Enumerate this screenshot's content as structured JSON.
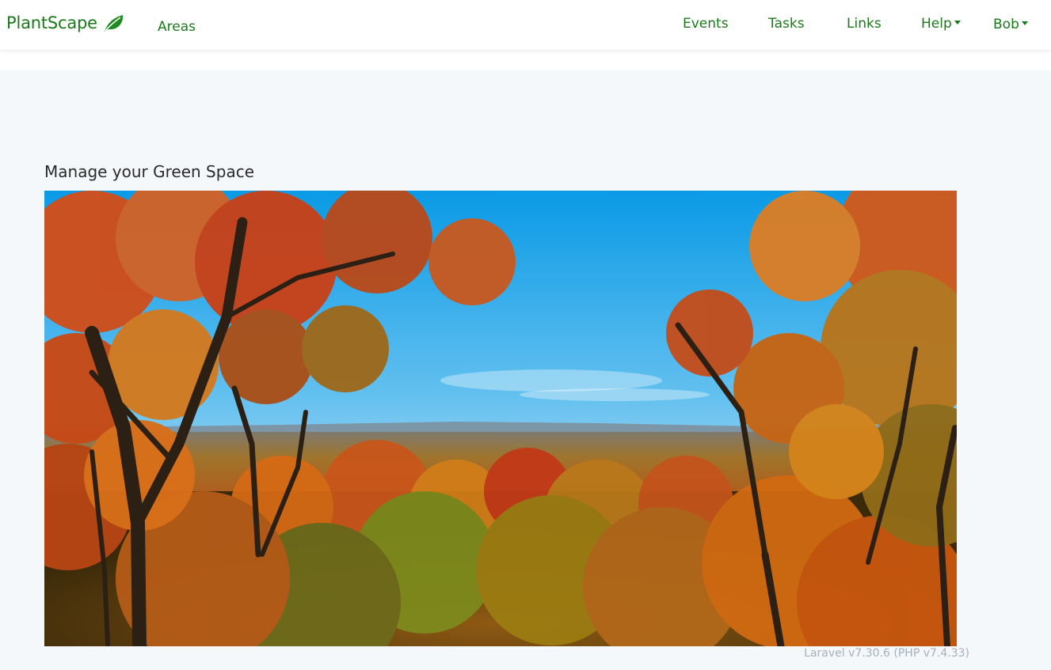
{
  "navbar": {
    "brand": "PlantScape",
    "areas": "Areas",
    "events": "Events",
    "tasks": "Tasks",
    "links": "Links",
    "help": "Help",
    "user": "Bob"
  },
  "main": {
    "heading": "Manage your Green Space",
    "image_icon": "autumn-forest-landscape-photo"
  },
  "footer": {
    "version": "Laravel v7.30.6 (PHP v7.4.33)"
  },
  "colors": {
    "brand_green": "#1a7a1a",
    "page_background": "#f5f8fb",
    "navbar_background": "#ffffff",
    "version_text": "#a6b0bb"
  }
}
